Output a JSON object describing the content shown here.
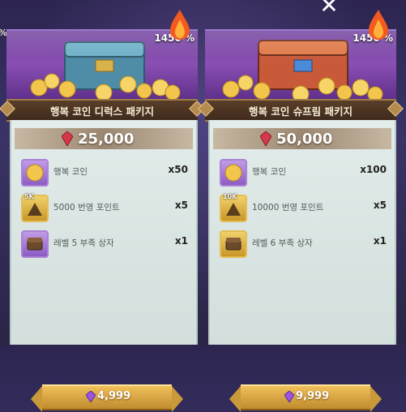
{
  "overlay": {
    "close_symbol": "✕",
    "left_edge_fragment": "%"
  },
  "colors": {
    "banner_purple": "#7a46a8",
    "title_brown": "#4a3322",
    "body_panel": "#d9e4e2",
    "button_gold": "#e3b24a",
    "ruby_gem": "#d5384b",
    "premium_gem": "#9b55e0"
  },
  "packages": [
    {
      "discount": "1450 %",
      "title": "행복 코인 디럭스 패키지",
      "price": "25,000",
      "items": [
        {
          "name": "행복 코인",
          "qty": "x50",
          "icon": "happy-coin-icon",
          "badge": ""
        },
        {
          "name": "5000 번영 포인트",
          "qty": "x5",
          "icon": "prosperity-points-icon",
          "badge": "5K"
        },
        {
          "name": "레벨 5 부족 상자",
          "qty": "x1",
          "icon": "tribe-chest-icon",
          "badge": ""
        }
      ],
      "buy_price": "4,999"
    },
    {
      "discount": "1450 %",
      "title": "행복 코인 슈프림 패키지",
      "price": "50,000",
      "items": [
        {
          "name": "행복 코인",
          "qty": "x100",
          "icon": "happy-coin-icon",
          "badge": ""
        },
        {
          "name": "10000 번영 포인트",
          "qty": "x5",
          "icon": "prosperity-points-icon",
          "badge": "10K"
        },
        {
          "name": "레벨 6 부족 상자",
          "qty": "x1",
          "icon": "tribe-chest-icon",
          "badge": ""
        }
      ],
      "buy_price": "9,999"
    }
  ]
}
